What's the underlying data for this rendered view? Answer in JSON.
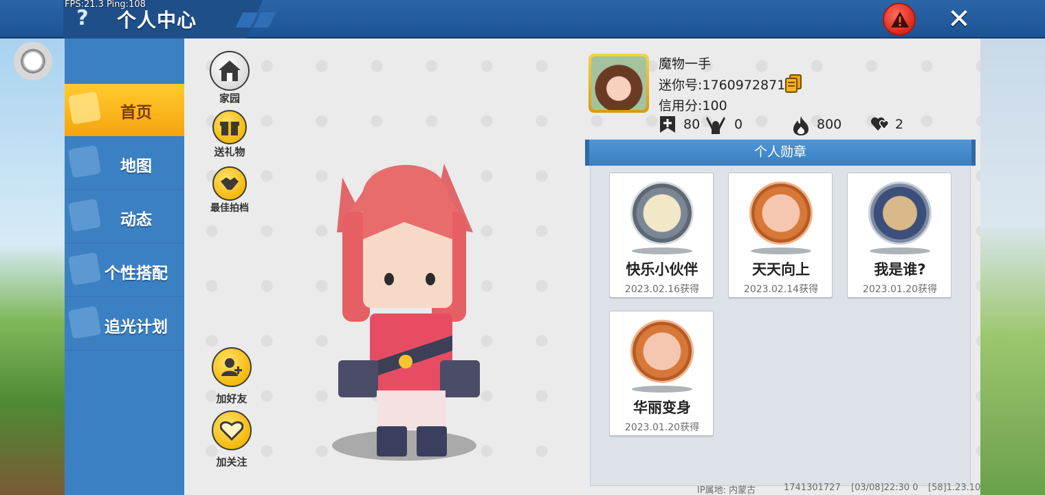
{
  "header": {
    "fps_text": "FPS:21.3  Ping:108",
    "help_label": "?",
    "title": "个人中心",
    "close_label": "✕"
  },
  "sidebar": {
    "items": [
      {
        "label": "首页",
        "active": true
      },
      {
        "label": "地图",
        "active": false
      },
      {
        "label": "动态",
        "active": false
      },
      {
        "label": "个性搭配",
        "active": false
      },
      {
        "label": "追光计划",
        "active": false
      }
    ]
  },
  "actions": {
    "home": "家园",
    "gift": "送礼物",
    "partner": "最佳拍档",
    "add_friend": "加好友",
    "follow": "加关注"
  },
  "profile": {
    "name": "魔物一手",
    "mini_id": "迷你号:1760972871",
    "credit": "信用分:100",
    "stats": {
      "bookmarks": "80",
      "fans": "0",
      "fire": "800",
      "likes": "2"
    }
  },
  "medals": {
    "section_title": "个人勋章",
    "items": [
      {
        "name": "快乐小伙伴",
        "date": "2023.02.16获得",
        "style": "silver"
      },
      {
        "name": "天天向上",
        "date": "2023.02.14获得",
        "style": "bronze"
      },
      {
        "name": "我是谁?",
        "date": "2023.01.20获得",
        "style": "steel"
      },
      {
        "name": "华丽变身",
        "date": "2023.01.20获得",
        "style": "bronze"
      }
    ]
  },
  "footer": {
    "ip_location": "IP属地: 内蒙古",
    "uid": "1741301727",
    "time": "[03/08]22:30 0",
    "version": "[58]1.23.10"
  }
}
